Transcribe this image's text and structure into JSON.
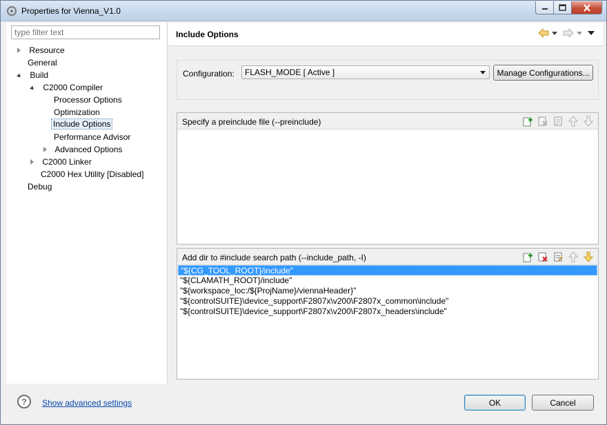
{
  "window": {
    "title": "Properties for Vienna_V1.0"
  },
  "filter": {
    "placeholder": "type filter text"
  },
  "tree": {
    "resource": "Resource",
    "general": "General",
    "build": "Build",
    "c2000_compiler": "C2000 Compiler",
    "processor_options": "Processor Options",
    "optimization": "Optimization",
    "include_options": "Include Options",
    "performance_advisor": "Performance Advisor",
    "advanced_options": "Advanced Options",
    "c2000_linker": "C2000 Linker",
    "c2000_hex_utility": "C2000 Hex Utility  [Disabled]",
    "debug": "Debug",
    "selected": "Include Options"
  },
  "page": {
    "title": "Include Options"
  },
  "configuration": {
    "label": "Configuration:",
    "value": "FLASH_MODE  [ Active ]",
    "manage_label": "Manage Configurations..."
  },
  "preinclude": {
    "title": "Specify a preinclude file (--preinclude)",
    "items": []
  },
  "include_path": {
    "title": "Add dir to #include search path (--include_path, -I)",
    "items": [
      "\"${CG_TOOL_ROOT}/include\"",
      "\"${CLAMATH_ROOT}/include\"",
      "\"${workspace_loc:/${ProjName}/viennaHeader}\"",
      "\"${controlSUITE}\\device_support\\F2807x\\v200\\F2807x_common\\include\"",
      "\"${controlSUITE}\\device_support\\F2807x\\v200\\F2807x_headers\\include\""
    ],
    "selected_index": 0
  },
  "icons": {
    "add": "add-icon",
    "delete": "delete-icon",
    "edit": "edit-icon",
    "move_up": "move-up-icon",
    "move_down": "move-down-icon",
    "help": "help-icon",
    "back": "back-arrow-icon",
    "forward": "forward-arrow-icon"
  },
  "bottom": {
    "help_glyph": "?",
    "advanced_link": "Show advanced settings",
    "ok_label": "OK",
    "cancel_label": "Cancel"
  },
  "colors": {
    "selection": "#3399ff",
    "link": "#0645ad",
    "close_button": "#c7503a"
  }
}
